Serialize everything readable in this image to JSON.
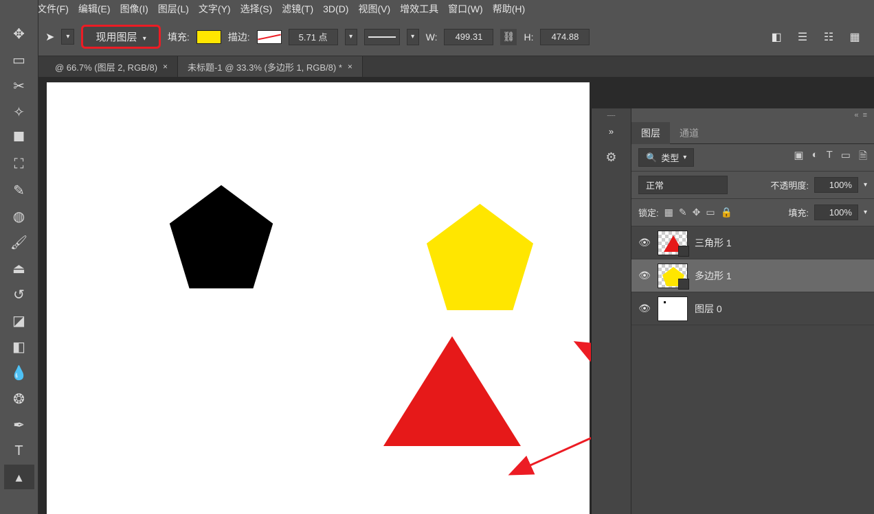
{
  "menu": {
    "file": "文件(F)",
    "edit": "编辑(E)",
    "image": "图像(I)",
    "layer": "图层(L)",
    "type": "文字(Y)",
    "select": "选择(S)",
    "filter": "滤镜(T)",
    "threeD": "3D(D)",
    "view": "视图(V)",
    "plugins": "增效工具",
    "window": "窗口(W)",
    "help": "帮助(H)"
  },
  "options": {
    "active_layer_label": "现用图层",
    "fill_label": "填充:",
    "stroke_label": "描边:",
    "stroke_width": "5.71 点",
    "w_label": "W:",
    "w_value": "499.31",
    "h_label": "H:",
    "h_value": "474.88"
  },
  "tabs": {
    "t1": "@ 66.7% (图层 2, RGB/8)",
    "t2": "未标题-1 @ 33.3% (多边形 1, RGB/8) *"
  },
  "panel": {
    "layers_tab": "图层",
    "channels_tab": "通道",
    "kind_label": "类型",
    "blend_mode": "正常",
    "opacity_label": "不透明度:",
    "opacity_value": "100%",
    "lock_label": "锁定:",
    "fill_label_r": "填充:",
    "fill_value_r": "100%",
    "search_icon_label": "🔍"
  },
  "layers": [
    {
      "name": "三角形 1",
      "selected": false,
      "kind": "triangle"
    },
    {
      "name": "多边形 1",
      "selected": true,
      "kind": "pentagon"
    },
    {
      "name": "图层 0",
      "selected": false,
      "kind": "raster"
    }
  ],
  "icons": {
    "eye": "👁",
    "link": "⛓",
    "collapse": "»",
    "collapse2": "«",
    "search": "🔍",
    "image_filter": "▣",
    "adjust": "◐",
    "type": "T",
    "shape": "▭",
    "smart": "🗎"
  }
}
